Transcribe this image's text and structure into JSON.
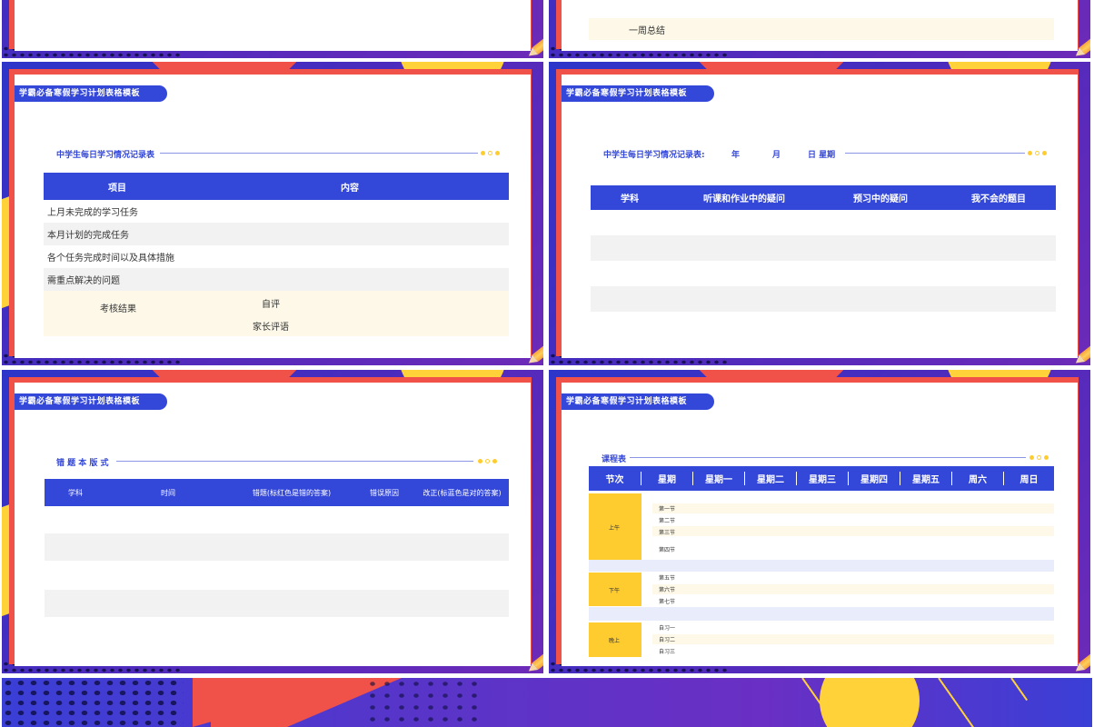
{
  "top_left": {
    "visible_text": ""
  },
  "top_right": {
    "summary_label": "一周总结"
  },
  "slide_header": "学霸必备寒假学习计划表格模板",
  "slide_a": {
    "title": "中学生每日学习情况记录表",
    "headers": [
      "项目",
      "内容"
    ],
    "rows": [
      "上月未完成的学习任务",
      "本月计划的完成任务",
      "各个任务完成时间以及具体措施",
      "需重点解决的问题"
    ],
    "assess_label": "考核结果",
    "self_eval": "自评",
    "parent_eval": "家长评语"
  },
  "slide_b": {
    "title": "中学生每日学习情况记录表:",
    "year": "年",
    "month": "月",
    "day_week": "日 星期",
    "headers": [
      "学科",
      "听课和作业中的疑问",
      "预习中的疑问",
      "我不会的题目"
    ]
  },
  "slide_c": {
    "title": "错 题 本 版 式",
    "headers": [
      "学科",
      "时间",
      "错题(标红色是错的答案)",
      "错误原因",
      "改正(标蓝色是对的答案)"
    ]
  },
  "slide_d": {
    "title": "课程表",
    "headers": [
      "节次",
      "星期",
      "星期一",
      "星期二",
      "星期三",
      "星期四",
      "星期五",
      "周六",
      "周日"
    ],
    "morning": "上午",
    "afternoon": "下午",
    "evening": "晚上",
    "morning_periods": [
      "第一节",
      "第二节",
      "第三节",
      "第四节"
    ],
    "afternoon_periods": [
      "第五节",
      "第六节",
      "第七节"
    ],
    "evening_periods": [
      "自习一",
      "自习二",
      "自习三"
    ]
  },
  "colors": {
    "blue": "#3347d9",
    "red": "#f0524a",
    "yellow": "#ffcc2f",
    "purple": "#4a2bbd"
  }
}
